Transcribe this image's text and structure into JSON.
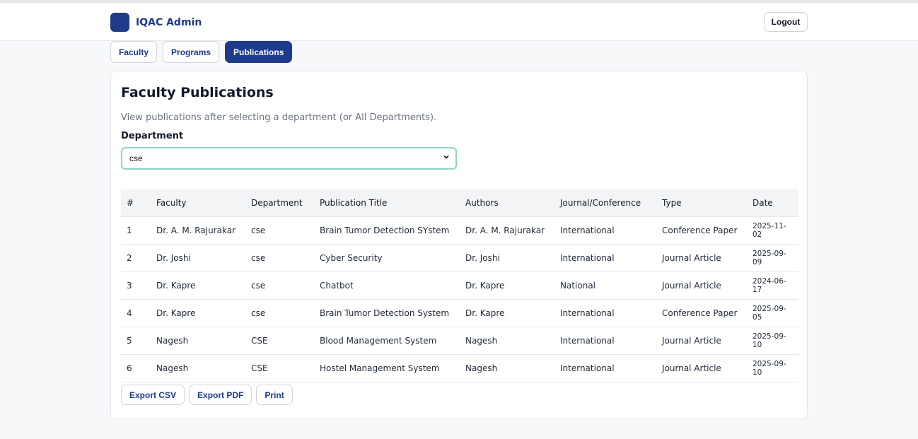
{
  "header": {
    "brand_name": "IQAC Admin",
    "logout_label": "Logout",
    "brand_color": "#1e3a8a"
  },
  "tabs": [
    {
      "label": "Faculty",
      "active": false
    },
    {
      "label": "Programs",
      "active": false
    },
    {
      "label": "Publications",
      "active": true
    }
  ],
  "main": {
    "title": "Faculty Publications",
    "description": "View publications after selecting a department (or All Departments).",
    "department_label": "Department",
    "department_value": "cse"
  },
  "table": {
    "headers": [
      "#",
      "Faculty",
      "Department",
      "Publication Title",
      "Authors",
      "Journal/Conference",
      "Type",
      "Date"
    ],
    "rows": [
      [
        "1",
        "Dr. A. M. Rajurakar",
        "cse",
        "Brain Tumor Detection SYstem",
        "Dr. A. M. Rajurakar",
        "International",
        "Conference Paper",
        "2025-11-02"
      ],
      [
        "2",
        "Dr. Joshi",
        "cse",
        "Cyber Security",
        "Dr. Joshi",
        "International",
        "Journal Article",
        "2025-09-09"
      ],
      [
        "3",
        "Dr. Kapre",
        "cse",
        "Chatbot",
        "Dr. Kapre",
        "National",
        "Journal Article",
        "2024-06-17"
      ],
      [
        "4",
        "Dr. Kapre",
        "cse",
        "Brain Tumor Detection System",
        "Dr. Kapre",
        "International",
        "Conference Paper",
        "2025-09-05"
      ],
      [
        "5",
        "Nagesh",
        "CSE",
        "Blood Management System",
        "Nagesh",
        "International",
        "Journal Article",
        "2025-09-10"
      ],
      [
        "6",
        "Nagesh",
        "CSE",
        "Hostel Management System",
        "Nagesh",
        "International",
        "Journal Article",
        "2025-09-10"
      ]
    ]
  },
  "actions": {
    "export_csv": "Export CSV",
    "export_pdf": "Export PDF",
    "print": "Print"
  },
  "icons": {
    "logo": "logo-square-icon",
    "select_arrow": "chevron-down-icon"
  }
}
